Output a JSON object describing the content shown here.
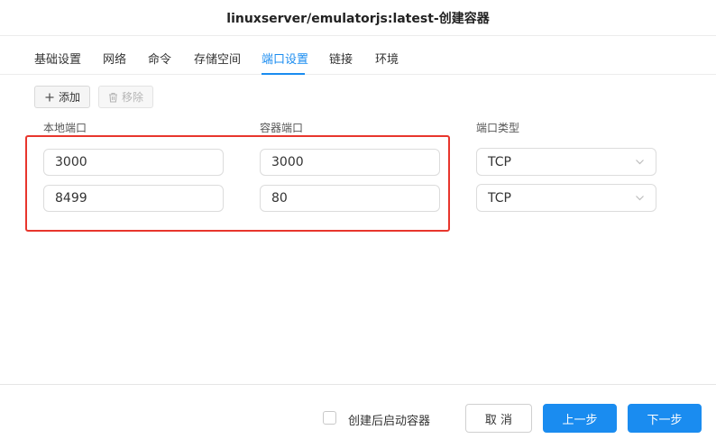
{
  "dialog": {
    "title": "linuxserver/emulatorjs:latest-创建容器"
  },
  "tabs": [
    {
      "label": "基础设置"
    },
    {
      "label": "网络"
    },
    {
      "label": "命令"
    },
    {
      "label": "存储空间"
    },
    {
      "label": "端口设置",
      "active": true
    },
    {
      "label": "链接"
    },
    {
      "label": "环境"
    }
  ],
  "toolbar": {
    "add_label": "添加",
    "remove_label": "移除"
  },
  "columns": {
    "local_port": "本地端口",
    "container_port": "容器端口",
    "port_type": "端口类型"
  },
  "ports": [
    {
      "local": "3000",
      "container": "3000",
      "type": "TCP"
    },
    {
      "local": "8499",
      "container": "80",
      "type": "TCP"
    }
  ],
  "footer": {
    "start_after_create_label": "创建后启动容器",
    "start_after_create_checked": false,
    "cancel_label": "取 消",
    "prev_label": "上一步",
    "next_label": "下一步"
  },
  "colors": {
    "accent": "#1a8cf0",
    "highlight": "#e8362d"
  },
  "icons": {
    "add": "plus-icon",
    "remove": "trash-icon",
    "select": "chevron-down-icon"
  }
}
